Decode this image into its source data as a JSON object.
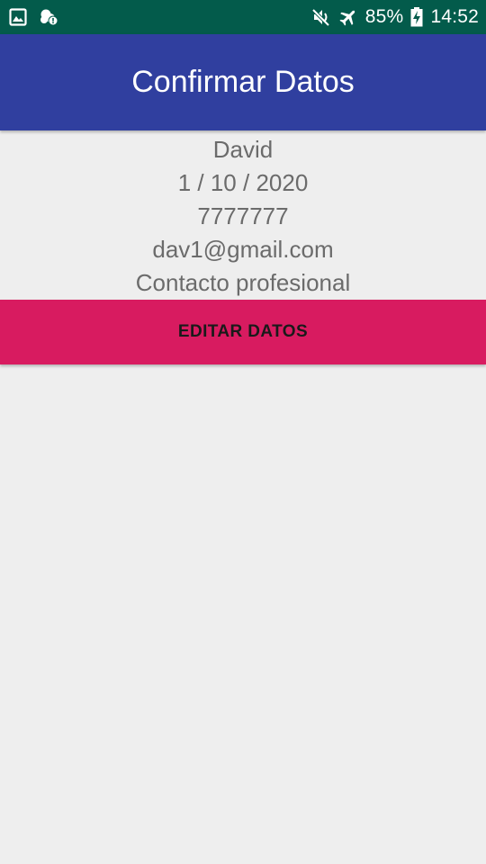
{
  "status_bar": {
    "battery": "85%",
    "time": "14:52",
    "icons": [
      "image-icon",
      "notification-icon",
      "mute-icon",
      "airplane-mode-icon",
      "battery-charging-icon"
    ]
  },
  "app_bar": {
    "title": "Confirmar Datos"
  },
  "contact": {
    "name": "David",
    "date": "1 / 10 / 2020",
    "phone": "7777777",
    "email": "dav1@gmail.com",
    "description": "Contacto profesional"
  },
  "actions": {
    "edit_label": "EDITAR DATOS"
  },
  "colors": {
    "status_bar": "#035b4b",
    "app_bar": "#303f9f",
    "accent_button": "#d81b60",
    "background": "#eeeeee",
    "text_secondary": "#6b6b6b"
  }
}
